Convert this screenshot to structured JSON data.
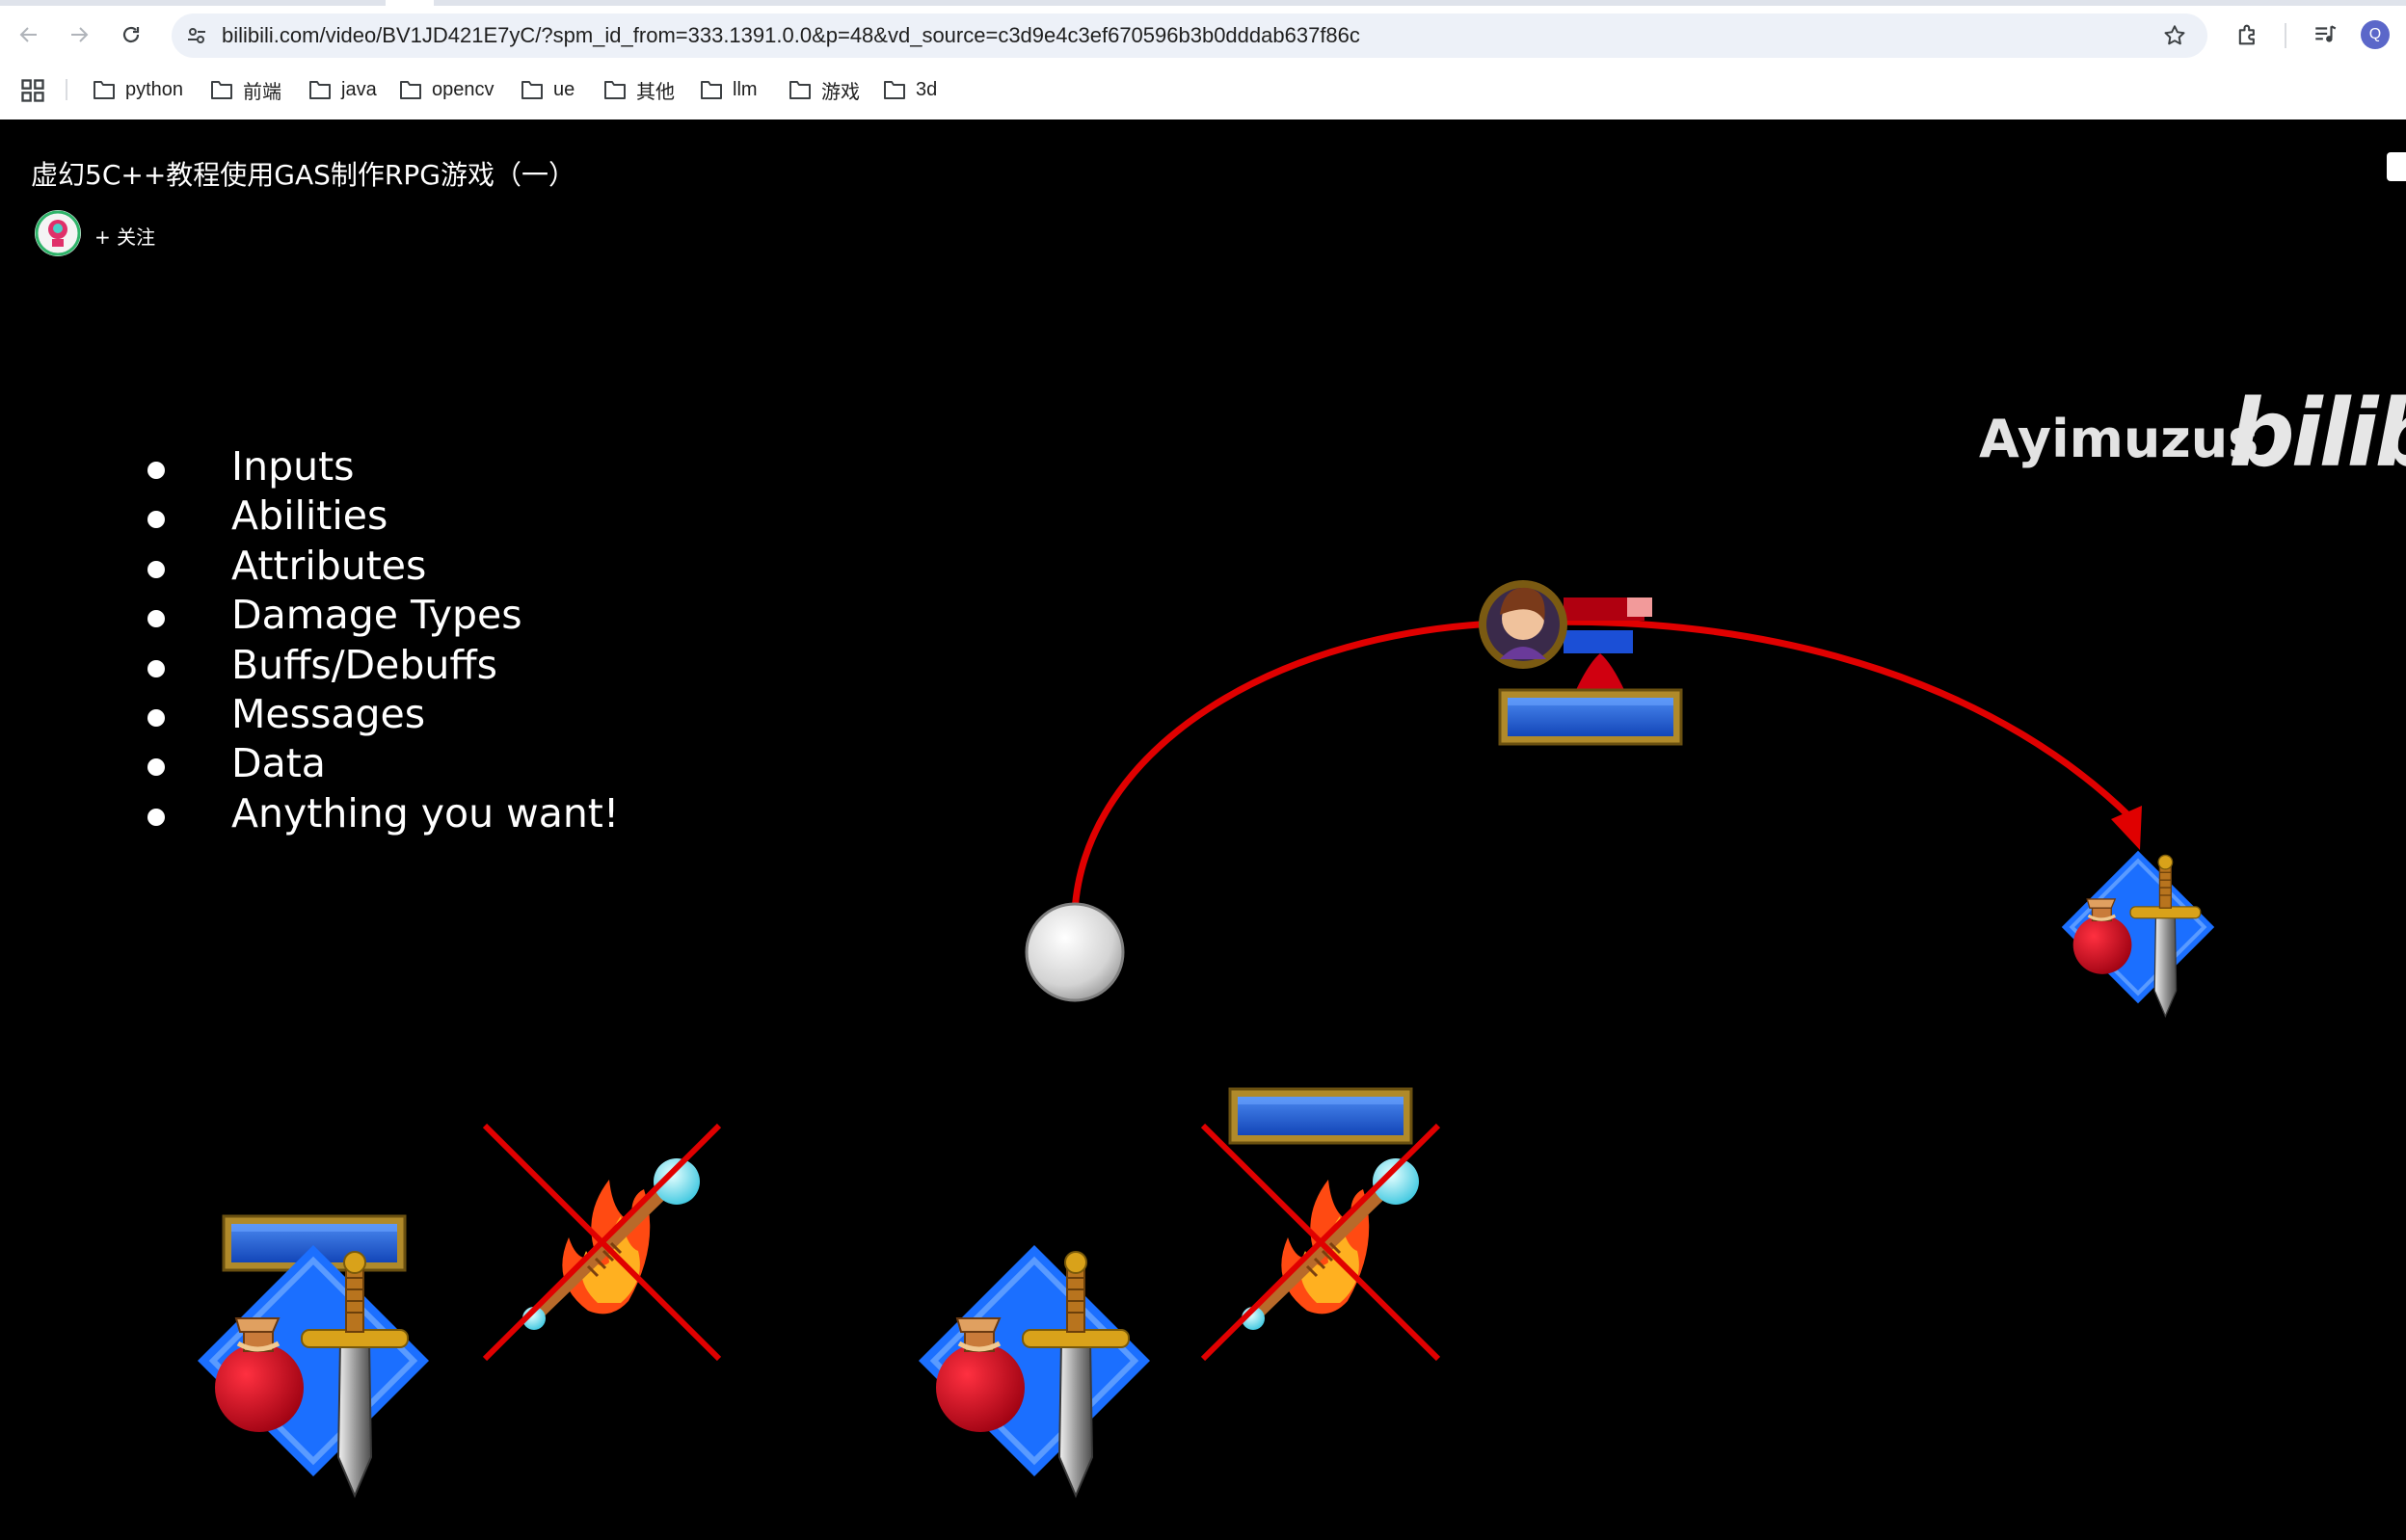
{
  "browser": {
    "url": "bilibili.com/video/BV1JD421E7yC/?spm_id_from=333.1391.0.0&p=48&vd_source=c3d9e4c3ef670596b3b0dddab637f86c",
    "profile_initial": "Q",
    "bookmarks": [
      "python",
      "前端",
      "java",
      "opencv",
      "ue",
      "其他",
      "llm",
      "游戏",
      "3d"
    ]
  },
  "video": {
    "title": "虚幻5C++教程使用GAS制作RPG游戏（一）",
    "follow_label": "+ 关注",
    "watermark_user": "Ayimuzus",
    "watermark_logo": "bilibili"
  },
  "slide": {
    "bullets": [
      "Inputs",
      "Abilities",
      "Attributes",
      "Damage Types",
      "Buffs/Debuffs",
      "Messages",
      "Data",
      "Anything you want!"
    ]
  },
  "colors": {
    "arrow": "#e00000",
    "gold": "#b08a2a",
    "bar_blue": "#1f63d6",
    "diamond_blue": "#2a72ff",
    "potion_red": "#d00010",
    "flame_orange": "#ff5a1a",
    "orb_cyan": "#7ff0ff"
  },
  "icons": [
    "back-icon",
    "forward-icon",
    "reload-icon",
    "site-info-icon",
    "star-icon",
    "extensions-icon",
    "media-icon",
    "apps-grid-icon",
    "folder-icon"
  ]
}
